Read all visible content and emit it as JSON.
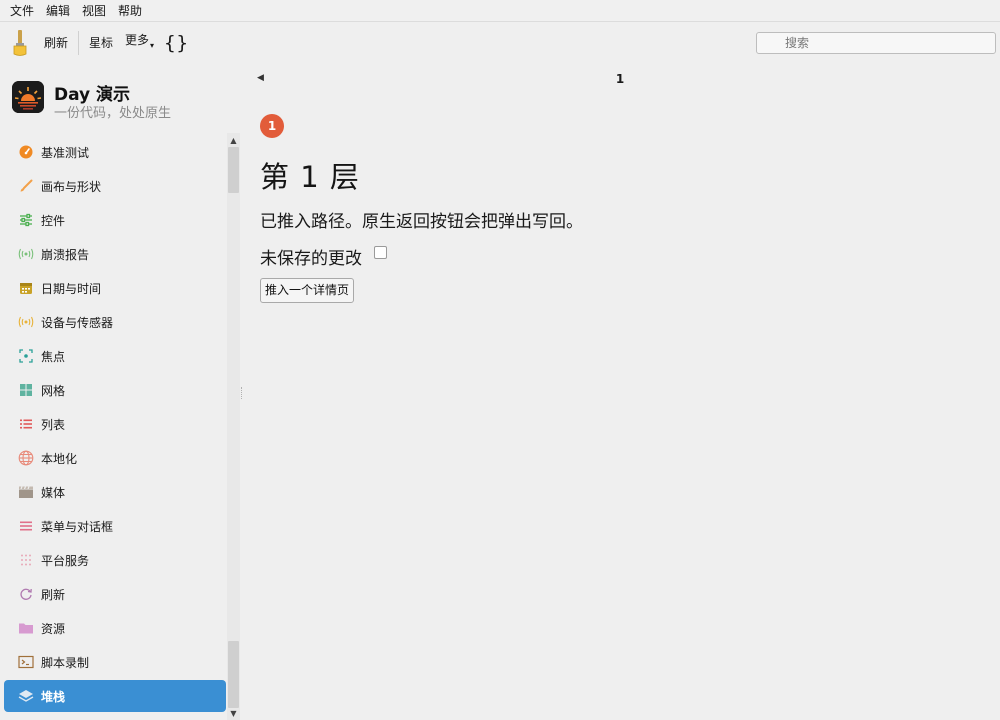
{
  "menubar": {
    "items": [
      "文件",
      "编辑",
      "视图",
      "帮助"
    ]
  },
  "toolbar": {
    "refresh_label": "刷新",
    "star_label": "星标",
    "more_label": "更多",
    "braces_label": "{}",
    "search_placeholder": "搜索"
  },
  "app": {
    "title": "Day 演示",
    "subtitle": "一份代码，处处原生"
  },
  "sidebar": {
    "items": [
      {
        "label": "基准测试",
        "icon": "gauge-icon",
        "color": "#f08a24"
      },
      {
        "label": "画布与形状",
        "icon": "paintbrush-icon",
        "color": "#f2a14a"
      },
      {
        "label": "控件",
        "icon": "sliders-icon",
        "color": "#4caf50"
      },
      {
        "label": "崩溃报告",
        "icon": "broadcast-icon",
        "color": "#7cc17c"
      },
      {
        "label": "日期与时间",
        "icon": "calendar-icon",
        "color": "#c9a227"
      },
      {
        "label": "设备与传感器",
        "icon": "sensor-icon",
        "color": "#e8b33a"
      },
      {
        "label": "焦点",
        "icon": "focus-icon",
        "color": "#2aa198"
      },
      {
        "label": "网格",
        "icon": "grid-icon",
        "color": "#5fb3a0"
      },
      {
        "label": "列表",
        "icon": "list-icon",
        "color": "#e05a5a"
      },
      {
        "label": "本地化",
        "icon": "globe-icon",
        "color": "#e88a7a"
      },
      {
        "label": "媒体",
        "icon": "clapperboard-icon",
        "color": "#a0958a"
      },
      {
        "label": "菜单与对话框",
        "icon": "menu-icon",
        "color": "#e0708a"
      },
      {
        "label": "平台服务",
        "icon": "dots-grid-icon",
        "color": "#e8a8b8"
      },
      {
        "label": "刷新",
        "icon": "refresh-icon",
        "color": "#b07ab0"
      },
      {
        "label": "资源",
        "icon": "folder-icon",
        "color": "#d79ad0"
      },
      {
        "label": "脚本录制",
        "icon": "terminal-icon",
        "color": "#a0703a"
      },
      {
        "label": "堆栈",
        "icon": "layers-icon",
        "color": "#ffffff",
        "active": true
      }
    ]
  },
  "main": {
    "nav_title": "1",
    "depth_badge": "1",
    "heading": "第 1 层",
    "description": "已推入路径。原生返回按钮会把弹出写回。",
    "unsaved_label": "未保存的更改",
    "unsaved_checked": false,
    "push_button_label": "推入一个详情页"
  },
  "colors": {
    "accent": "#3a8fd3",
    "badge": "#e25c3a"
  }
}
